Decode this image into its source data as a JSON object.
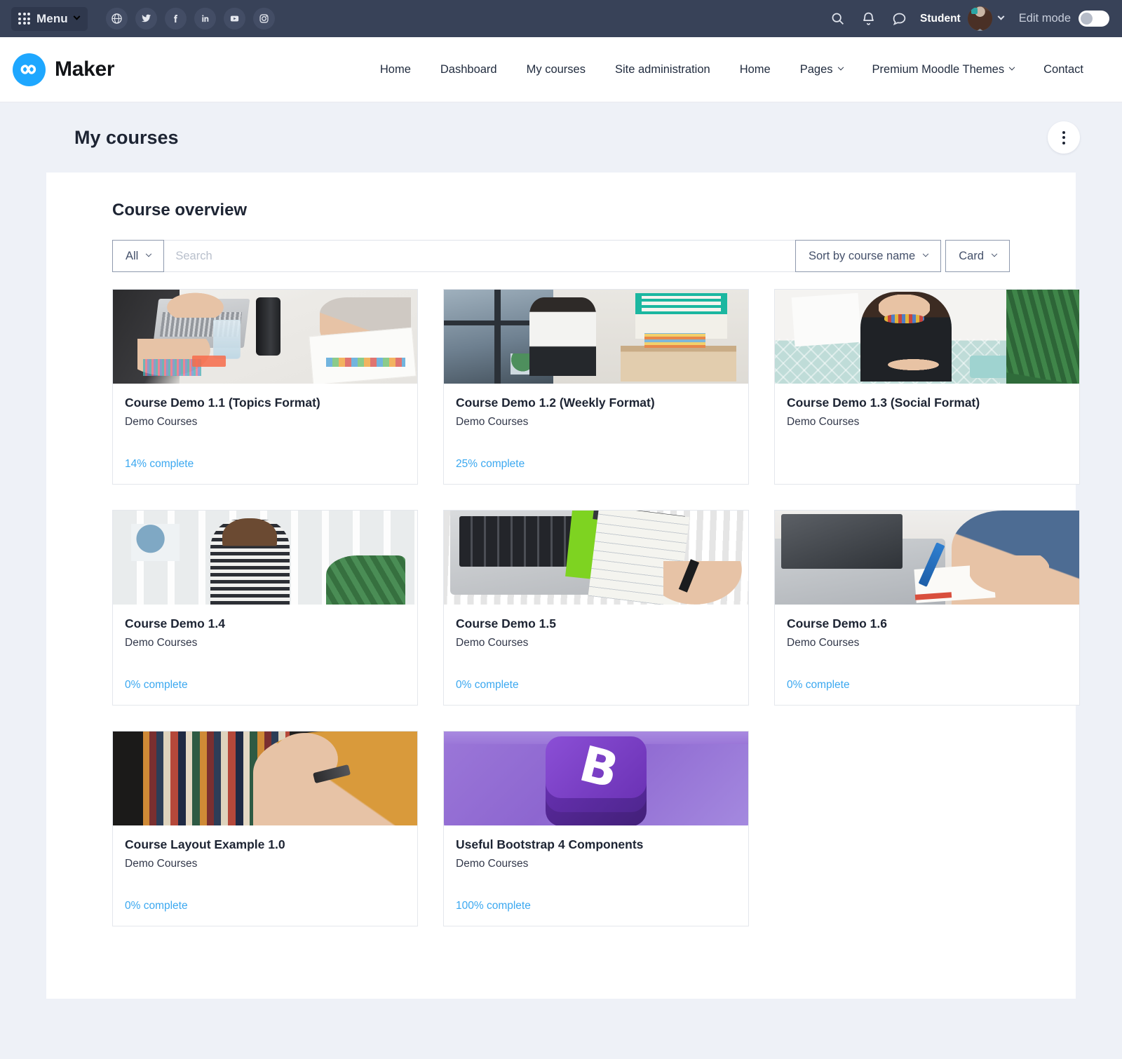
{
  "topbar": {
    "menu_label": "Menu",
    "social_icons": [
      "globe-icon",
      "twitter-icon",
      "facebook-icon",
      "linkedin-icon",
      "youtube-icon",
      "instagram-icon"
    ],
    "search_icon": "search-icon",
    "notifications_icon": "bell-icon",
    "messages_icon": "chat-bubble-icon",
    "username": "Student",
    "avatar": "user-avatar",
    "edit_mode_label": "Edit mode",
    "edit_mode_on": false
  },
  "navbar": {
    "brand": "Maker",
    "brand_icon": "infinity-logo-icon",
    "links": [
      {
        "label": "Home",
        "has_caret": false
      },
      {
        "label": "Dashboard",
        "has_caret": false
      },
      {
        "label": "My courses",
        "has_caret": false
      },
      {
        "label": "Site administration",
        "has_caret": false
      },
      {
        "label": "Home",
        "has_caret": false
      },
      {
        "label": "Pages",
        "has_caret": true
      },
      {
        "label": "Premium Moodle Themes",
        "has_caret": true
      },
      {
        "label": "Contact",
        "has_caret": false
      }
    ]
  },
  "page": {
    "title": "My courses",
    "actions_icon": "kebab-menu-icon"
  },
  "overview": {
    "heading": "Course overview",
    "filter_label": "All",
    "search_placeholder": "Search",
    "search_value": "",
    "sort_label": "Sort by course name",
    "view_label": "Card",
    "progress_color": "#3ba8f0"
  },
  "courses": [
    {
      "title": "Course Demo 1.1 (Topics Format)",
      "category": "Demo Courses",
      "progress": "14% complete",
      "thumb": "desk-laptop-photo"
    },
    {
      "title": "Course Demo 1.2 (Weekly Format)",
      "category": "Demo Courses",
      "progress": "25% complete",
      "thumb": "woman-reading-window-photo"
    },
    {
      "title": "Course Demo 1.3 (Social Format)",
      "category": "Demo Courses",
      "progress": "",
      "thumb": "woman-on-sofa-photo"
    },
    {
      "title": "Course Demo 1.4",
      "category": "Demo Courses",
      "progress": "0% complete",
      "thumb": "woman-wall-of-notes-photo"
    },
    {
      "title": "Course Demo 1.5",
      "category": "Demo Courses",
      "progress": "0% complete",
      "thumb": "laptop-notepad-wood-photo"
    },
    {
      "title": "Course Demo 1.6",
      "category": "Demo Courses",
      "progress": "0% complete",
      "thumb": "writing-beside-laptop-photo"
    },
    {
      "title": "Course Layout Example 1.0",
      "category": "Demo Courses",
      "progress": "0% complete",
      "thumb": "bookshelf-photo"
    },
    {
      "title": "Useful Bootstrap 4 Components",
      "category": "Demo Courses",
      "progress": "100% complete",
      "thumb": "bootstrap-logo-graphic"
    }
  ]
}
